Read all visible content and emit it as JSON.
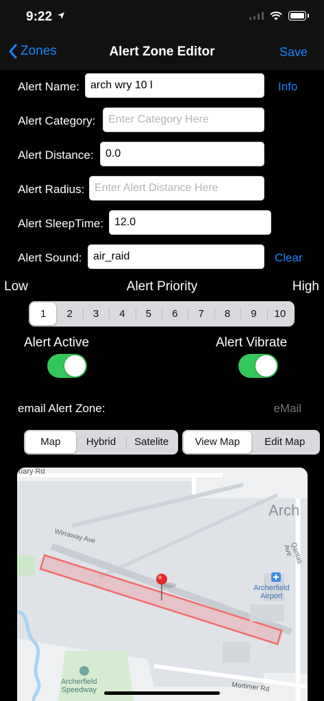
{
  "status": {
    "time": "9:22"
  },
  "nav": {
    "back_label": "Zones",
    "title": "Alert Zone Editor",
    "save_label": "Save"
  },
  "form": {
    "name": {
      "label": "Alert Name:",
      "value": "arch wry 10 l",
      "action": "Info"
    },
    "category": {
      "label": "Alert Category:",
      "placeholder": "Enter Category Here"
    },
    "distance": {
      "label": "Alert Distance:",
      "value": "0.0"
    },
    "radius": {
      "label": "Alert Radius:",
      "placeholder": "Enter Alert Distance Here"
    },
    "sleep": {
      "label": "Alert SleepTime:",
      "value": "12.0"
    },
    "sound": {
      "label": "Alert Sound:",
      "value": "air_raid",
      "action": "Clear"
    }
  },
  "priority": {
    "low": "Low",
    "title": "Alert Priority",
    "high": "High",
    "options": [
      "1",
      "2",
      "3",
      "4",
      "5",
      "6",
      "7",
      "8",
      "9",
      "10"
    ],
    "selected": "1"
  },
  "toggles": {
    "active": {
      "label": "Alert Active",
      "on": true
    },
    "vibrate": {
      "label": "Alert Vibrate",
      "on": true
    }
  },
  "email": {
    "label": "email Alert Zone:",
    "placeholder": "eMail"
  },
  "map_type": {
    "options": [
      "Map",
      "Hybrid",
      "Satelite"
    ],
    "selected": "Map"
  },
  "map_mode": {
    "options": [
      "View Map",
      "Edit Map"
    ],
    "selected": "View Map"
  },
  "map": {
    "labels": {
      "road_top": "uary Rd",
      "avenue": "Wirraway Ave",
      "town_partial": "Arch",
      "qantas": "Qantas Ave",
      "airport": "Archerfield\nAirport",
      "speedway": "Archerfield\nSpeedway",
      "mortimer": "Mortimer Rd"
    },
    "zone_color": "#f26b6b"
  },
  "colors": {
    "accent": "#1a84ff",
    "toggle_on": "#34c759"
  }
}
